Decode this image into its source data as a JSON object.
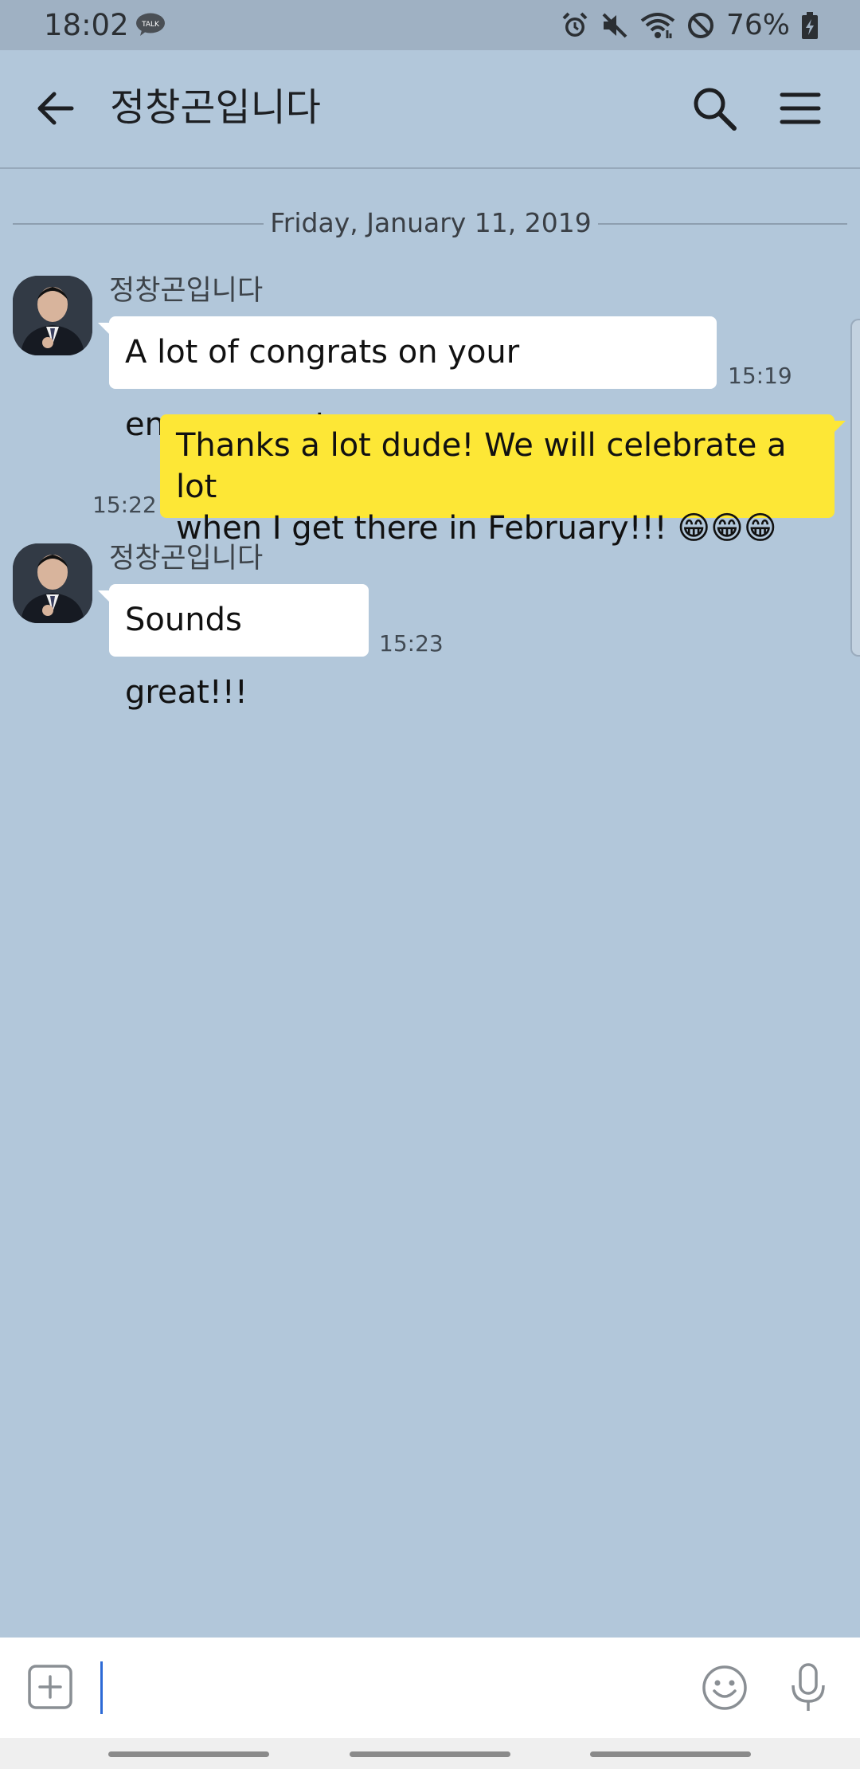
{
  "status_bar": {
    "time": "18:02",
    "notification_icons": [
      "kakaotalk-talk-icon"
    ],
    "system_icons": [
      "alarm-icon",
      "mute-icon",
      "wifi-icon",
      "do-not-disturb-icon",
      "battery-charging-icon"
    ],
    "battery_percent": "76%"
  },
  "app_bar": {
    "title": "정창곤입니다",
    "back_icon": "arrow-left-icon",
    "search_icon": "search-icon",
    "menu_icon": "hamburger-menu-icon"
  },
  "chat": {
    "date_separator": "Friday, January 11, 2019",
    "messages": [
      {
        "direction": "incoming",
        "sender": "정창곤입니다",
        "text": "A lot of congrats on your engagement",
        "time": "15:19"
      },
      {
        "direction": "outgoing",
        "text_line1": "Thanks a lot dude! We will celebrate a lot",
        "text_line2": "when I get there in February!!! 😁😁😁",
        "time": "15:22"
      },
      {
        "direction": "incoming",
        "sender": "정창곤입니다",
        "text": "Sounds great!!!",
        "time": "15:23"
      }
    ]
  },
  "input_bar": {
    "attach_icon": "plus-square-icon",
    "text_value": "",
    "emoji_icon": "emoji-face-icon",
    "mic_icon": "microphone-icon"
  },
  "colors": {
    "chat_background": "#b2c7da",
    "outgoing_bubble": "#fde736",
    "incoming_bubble": "#ffffff",
    "caret": "#2d6ad6"
  }
}
